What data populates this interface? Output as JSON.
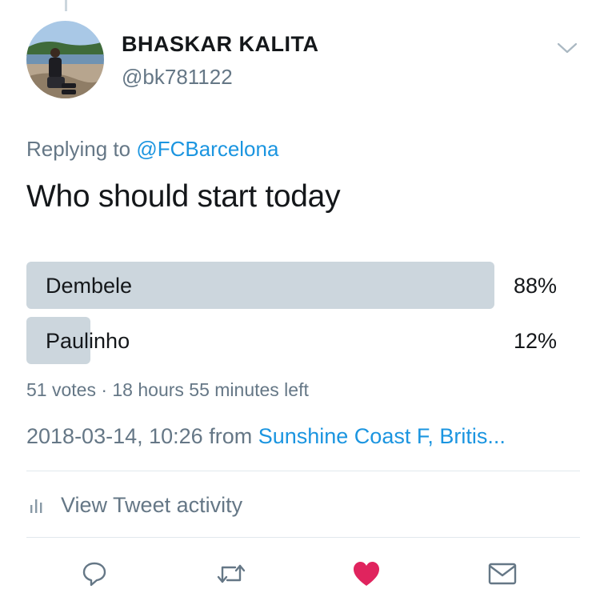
{
  "tweet": {
    "author": {
      "name": "BHASKAR KALITA",
      "handle": "@bk781122"
    },
    "replying_prefix": "Replying to",
    "replying_to": "@FCBarcelona",
    "text": "Who should start today"
  },
  "poll": {
    "options": [
      {
        "label": "Dembele",
        "percent": "88%",
        "fraction": 0.88
      },
      {
        "label": "Paulinho",
        "percent": "12%",
        "fraction": 0.12
      }
    ],
    "meta": "51 votes · 18 hours 55 minutes left"
  },
  "timestamp": {
    "datetime": "2018-03-14, 10:26",
    "from_word": "from",
    "location": "Sunshine Coast F, Britis..."
  },
  "activity": {
    "label": "View Tweet activity",
    "icon": "bar-chart-icon"
  },
  "actions": {
    "reply_icon": "reply-icon",
    "retweet_icon": "retweet-icon",
    "like_icon": "heart-icon",
    "share_icon": "envelope-icon"
  },
  "colors": {
    "link": "#1b95e0",
    "secondary_text": "#657786",
    "poll_bar": "#ccd6dd",
    "like": "#e0245e",
    "divider": "#e1e8ed"
  }
}
